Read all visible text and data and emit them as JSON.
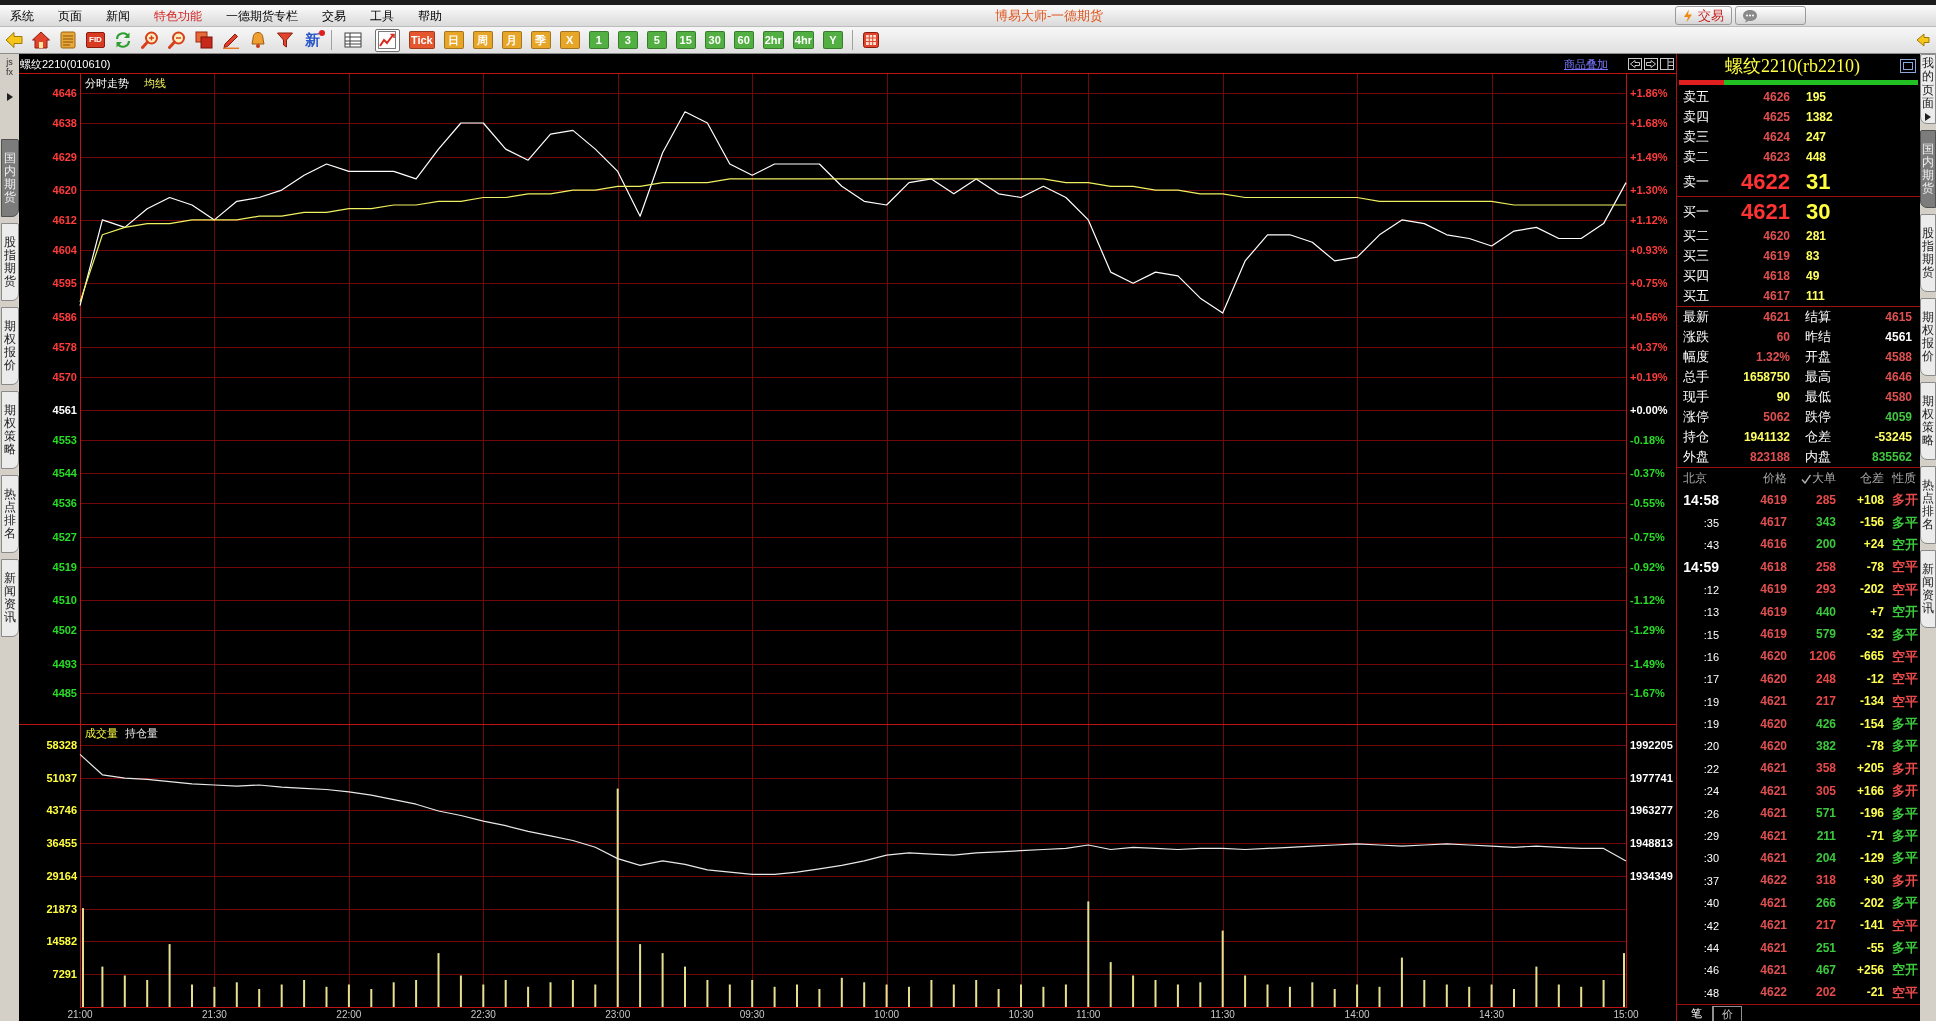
{
  "menu_bar": {
    "items": [
      {
        "label": "系统",
        "highlighted": false
      },
      {
        "label": "页面",
        "highlighted": false
      },
      {
        "label": "新闻",
        "highlighted": false
      },
      {
        "label": "特色功能",
        "highlighted": true
      },
      {
        "label": "一德期货专栏",
        "highlighted": false
      },
      {
        "label": "交易",
        "highlighted": false
      },
      {
        "label": "工具",
        "highlighted": false
      },
      {
        "label": "帮助",
        "highlighted": false
      }
    ],
    "app_title": "博易大师-一德期货",
    "trade_button": "交易"
  },
  "toolbar": {
    "fid_label": "FID",
    "news_label": "新",
    "view_buttons": [
      {
        "kind": "table",
        "selected": false
      },
      {
        "kind": "chart",
        "selected": true
      }
    ],
    "period_buttons": [
      {
        "label": "Tick",
        "color": "#e4572e"
      },
      {
        "label": "日",
        "color": "#e8a628"
      },
      {
        "label": "周",
        "color": "#e8a628"
      },
      {
        "label": "月",
        "color": "#e8a628"
      },
      {
        "label": "季",
        "color": "#e8a628"
      },
      {
        "label": "X",
        "color": "#e8a628"
      },
      {
        "label": "1",
        "color": "#52b043"
      },
      {
        "label": "3",
        "color": "#52b043"
      },
      {
        "label": "5",
        "color": "#52b043"
      },
      {
        "label": "15",
        "color": "#52b043"
      },
      {
        "label": "30",
        "color": "#52b043"
      },
      {
        "label": "60",
        "color": "#52b043"
      },
      {
        "label": "2hr",
        "color": "#52b043"
      },
      {
        "label": "4hr",
        "color": "#52b043"
      },
      {
        "label": "Y",
        "color": "#52b043"
      }
    ]
  },
  "left_tabs": {
    "script_label": "js fx",
    "tabs": [
      {
        "label": "国内期货",
        "selected": true
      },
      {
        "label": "股指期货",
        "selected": false
      },
      {
        "label": "期权报价",
        "selected": false
      },
      {
        "label": "期权策略",
        "selected": false
      },
      {
        "label": "热点排名",
        "selected": false
      },
      {
        "label": "新闻资讯",
        "selected": false
      }
    ]
  },
  "price_chart": {
    "symbol": "螺纹2210(010610)",
    "overlay_link": "商品叠加",
    "percent_labels": [
      {
        "text": "+1.86%",
        "color": "#ff3c3c"
      },
      {
        "text": "+1.68%",
        "color": "#ff3c3c"
      },
      {
        "text": "+1.49%",
        "color": "#ff3c3c"
      },
      {
        "text": "+1.30%",
        "color": "#ff3c3c"
      },
      {
        "text": "+1.12%",
        "color": "#ff3c3c"
      },
      {
        "text": "+0.93%",
        "color": "#ff3c3c"
      },
      {
        "text": "+0.75%",
        "color": "#ff3c3c"
      },
      {
        "text": "+0.56%",
        "color": "#ff3c3c"
      },
      {
        "text": "+0.37%",
        "color": "#ff3c3c"
      },
      {
        "text": "+0.19%",
        "color": "#ff3c3c"
      },
      {
        "text": "+0.00%",
        "color": "#ffffff"
      },
      {
        "text": "-0.18%",
        "color": "#28dc28"
      },
      {
        "text": "-0.37%",
        "color": "#28dc28"
      },
      {
        "text": "-0.55%",
        "color": "#28dc28"
      },
      {
        "text": "-0.75%",
        "color": "#28dc28"
      },
      {
        "text": "-0.92%",
        "color": "#28dc28"
      },
      {
        "text": "-1.12%",
        "color": "#28dc28"
      },
      {
        "text": "-1.29%",
        "color": "#28dc28"
      },
      {
        "text": "-1.49%",
        "color": "#28dc28"
      },
      {
        "text": "-1.67%",
        "color": "#28dc28"
      }
    ],
    "chart_data": {
      "type": "line",
      "grid": true,
      "series": [
        {
          "name": "分时走势",
          "color": "#ffffff",
          "values": [
            4589,
            4612,
            4610,
            4615,
            4618,
            4616,
            4612,
            4617,
            4618,
            4620,
            4624,
            4627,
            4625,
            4625,
            4625,
            4623,
            4631,
            4638,
            4638,
            4631,
            4628,
            4635,
            4636,
            4631,
            4625,
            4613,
            4630,
            4641,
            4638,
            4627,
            4624,
            4627,
            4627,
            4627,
            4621,
            4617,
            4616,
            4622,
            4623,
            4619,
            4623,
            4619,
            4618,
            4621,
            4618,
            4612,
            4598,
            4595,
            4598,
            4597,
            4591,
            4587,
            4601,
            4608,
            4608,
            4606,
            4601,
            4602,
            4608,
            4612,
            4611,
            4608,
            4607,
            4605,
            4609,
            4610,
            4607,
            4607,
            4611,
            4622
          ]
        },
        {
          "name": "均线",
          "color": "#f0f060",
          "values": [
            4590,
            4608,
            4610,
            4611,
            4611,
            4612,
            4612,
            4612,
            4613,
            4613,
            4614,
            4614,
            4615,
            4615,
            4616,
            4616,
            4617,
            4617,
            4618,
            4618,
            4619,
            4619,
            4620,
            4620,
            4621,
            4621,
            4622,
            4622,
            4622,
            4623,
            4623,
            4623,
            4623,
            4623,
            4623,
            4623,
            4623,
            4623,
            4623,
            4623,
            4623,
            4623,
            4623,
            4623,
            4622,
            4622,
            4621,
            4621,
            4620,
            4620,
            4619,
            4619,
            4618,
            4618,
            4618,
            4618,
            4618,
            4618,
            4617,
            4617,
            4617,
            4617,
            4617,
            4617,
            4616,
            4616,
            4616,
            4616,
            4616,
            4616
          ]
        }
      ],
      "ylim": [
        4476.8,
        4651.4
      ],
      "yticks": [
        4646,
        4638,
        4629,
        4620,
        4612,
        4604,
        4595,
        4586,
        4578,
        4570,
        4561,
        4553,
        4544,
        4536,
        4527,
        4519,
        4510,
        4502,
        4493,
        4485
      ]
    }
  },
  "volume_chart": {
    "chart_data": {
      "type": "bar",
      "grid": true,
      "categories": [
        "21:00",
        null,
        null,
        null,
        null,
        null,
        "21:30",
        null,
        null,
        null,
        null,
        null,
        "22:00",
        null,
        null,
        null,
        null,
        null,
        "22:30",
        null,
        null,
        null,
        null,
        null,
        "23:00",
        null,
        null,
        null,
        null,
        null,
        "09:30",
        null,
        null,
        null,
        null,
        null,
        "10:00",
        null,
        null,
        null,
        null,
        null,
        "10:30",
        null,
        null,
        "11:00",
        null,
        null,
        null,
        null,
        null,
        "11:30",
        null,
        null,
        null,
        null,
        null,
        "14:00",
        null,
        null,
        null,
        null,
        null,
        "14:30",
        null,
        null,
        null,
        null,
        null,
        "15:00"
      ],
      "series": [
        {
          "name": "成交量",
          "color": "#e6e08c",
          "values": [
            22000,
            9000,
            7000,
            6000,
            14000,
            5000,
            4500,
            5500,
            4000,
            5000,
            6000,
            4500,
            5000,
            4000,
            5500,
            6000,
            12000,
            7000,
            5000,
            6000,
            4500,
            5500,
            6000,
            5000,
            48600,
            14000,
            12000,
            9000,
            6000,
            5000,
            6000,
            4500,
            5000,
            4000,
            6500,
            5500,
            5000,
            4500,
            6000,
            5000,
            6000,
            4000,
            5000,
            4500,
            5000,
            23500,
            10000,
            7000,
            6000,
            5000,
            5500,
            17000,
            7000,
            5000,
            4500,
            5500,
            4000,
            5000,
            4500,
            11000,
            6000,
            5000,
            4500,
            5000,
            4000,
            9000,
            5000,
            4500,
            6000,
            12000
          ]
        }
      ],
      "ylim": [
        0,
        62967
      ],
      "yticks": [
        58328,
        51037,
        43746,
        36455,
        29164,
        21873,
        14582,
        7291
      ]
    }
  },
  "open_interest_chart": {
    "chart_data": {
      "type": "line",
      "series": [
        {
          "name": "持仓量",
          "color": "#e8e8e8",
          "values": [
            1988000,
            1979000,
            1977500,
            1977000,
            1976000,
            1975000,
            1974500,
            1974000,
            1974500,
            1973500,
            1973000,
            1972500,
            1971500,
            1970000,
            1968000,
            1966000,
            1963000,
            1961000,
            1958500,
            1956500,
            1954000,
            1952000,
            1950000,
            1947000,
            1942000,
            1939000,
            1941000,
            1939500,
            1937000,
            1936000,
            1935000,
            1935000,
            1936000,
            1937500,
            1939000,
            1941000,
            1943500,
            1944500,
            1944000,
            1943500,
            1944500,
            1945000,
            1945500,
            1946000,
            1946500,
            1948000,
            1946000,
            1947000,
            1946500,
            1946000,
            1946500,
            1946500,
            1946000,
            1946500,
            1947000,
            1947500,
            1948000,
            1948500,
            1948000,
            1947500,
            1948000,
            1948500,
            1948000,
            1947500,
            1947000,
            1947500,
            1947000,
            1946500,
            1946500,
            1941000
          ]
        }
      ],
      "ylim": [
        1934349,
        1992205
      ],
      "yticks": [
        1992205,
        1977741,
        1963277,
        1948813,
        1934349
      ]
    }
  },
  "quote_panel": {
    "title": "螺纹2210(rb2210)",
    "ratio_bar": {
      "level": 0.19
    },
    "asks": [
      {
        "label": "卖五",
        "price": "4626",
        "volume": "195",
        "kind": "level"
      },
      {
        "label": "卖四",
        "price": "4625",
        "volume": "1382",
        "kind": "level"
      },
      {
        "label": "卖三",
        "price": "4624",
        "volume": "247",
        "kind": "level"
      },
      {
        "label": "卖二",
        "price": "4623",
        "volume": "448",
        "kind": "level"
      },
      {
        "label": "卖一",
        "price": "4622",
        "volume": "31",
        "kind": "best"
      }
    ],
    "bids": [
      {
        "label": "买一",
        "price": "4621",
        "volume": "30",
        "kind": "best"
      },
      {
        "label": "买二",
        "price": "4620",
        "volume": "281",
        "kind": "level"
      },
      {
        "label": "买三",
        "price": "4619",
        "volume": "83",
        "kind": "level"
      },
      {
        "label": "买四",
        "price": "4618",
        "volume": "49",
        "kind": "level"
      },
      {
        "label": "买五",
        "price": "4617",
        "volume": "111",
        "kind": "level"
      }
    ],
    "stats": [
      {
        "label": "最新",
        "value": "4621",
        "color": "#e05050"
      },
      {
        "label": "结算",
        "value": "4615",
        "color": "#e05050"
      },
      {
        "label": "涨跌",
        "value": "60",
        "color": "#e05050"
      },
      {
        "label": "昨结",
        "value": "4561",
        "color": "#ffffff"
      },
      {
        "label": "幅度",
        "value": "1.32%",
        "color": "#e05050"
      },
      {
        "label": "开盘",
        "value": "4588",
        "color": "#e05050"
      },
      {
        "label": "总手",
        "value": "1658750",
        "color": "#ffff60"
      },
      {
        "label": "最高",
        "value": "4646",
        "color": "#e05050"
      },
      {
        "label": "现手",
        "value": "90",
        "color": "#ffff60"
      },
      {
        "label": "最低",
        "value": "4580",
        "color": "#e05050"
      },
      {
        "label": "涨停",
        "value": "5062",
        "color": "#e05050"
      },
      {
        "label": "跌停",
        "value": "4059",
        "color": "#40c840"
      },
      {
        "label": "持仓",
        "value": "1941132",
        "color": "#ffff60"
      },
      {
        "label": "仓差",
        "value": "-53245",
        "color": "#ffff60"
      },
      {
        "label": "外盘",
        "value": "823188",
        "color": "#e05050"
      },
      {
        "label": "内盘",
        "value": "835562",
        "color": "#40c840"
      }
    ],
    "trades": {
      "columns": [
        "北京",
        "价格",
        "大单",
        "仓差",
        "性质"
      ],
      "big_order_filter": {
        "checked": true
      },
      "rows": [
        {
          "time": "14:58",
          "kind": "minute",
          "price": "4619",
          "volume": {
            "text": "285",
            "color": "#e84a4a"
          },
          "change": "+108",
          "nature": {
            "text": "多开",
            "color": "#e84a4a"
          }
        },
        {
          "time": ":35",
          "kind": "second",
          "price": "4617",
          "volume": {
            "text": "343",
            "color": "#3cc83c"
          },
          "change": "-156",
          "nature": {
            "text": "多平",
            "color": "#3cc83c"
          }
        },
        {
          "time": ":43",
          "kind": "second",
          "price": "4616",
          "volume": {
            "text": "200",
            "color": "#3cc83c"
          },
          "change": "+24",
          "nature": {
            "text": "空开",
            "color": "#3cc83c"
          }
        },
        {
          "time": "14:59",
          "kind": "minute",
          "price": "4618",
          "volume": {
            "text": "258",
            "color": "#e84a4a"
          },
          "change": "-78",
          "nature": {
            "text": "空平",
            "color": "#e84a4a"
          }
        },
        {
          "time": ":12",
          "kind": "second",
          "price": "4619",
          "volume": {
            "text": "293",
            "color": "#e84a4a"
          },
          "change": "-202",
          "nature": {
            "text": "空平",
            "color": "#e84a4a"
          }
        },
        {
          "time": ":13",
          "kind": "second",
          "price": "4619",
          "volume": {
            "text": "440",
            "color": "#3cc83c"
          },
          "change": "+7",
          "nature": {
            "text": "空开",
            "color": "#3cc83c"
          }
        },
        {
          "time": ":15",
          "kind": "second",
          "price": "4619",
          "volume": {
            "text": "579",
            "color": "#3cc83c"
          },
          "change": "-32",
          "nature": {
            "text": "多平",
            "color": "#3cc83c"
          }
        },
        {
          "time": ":16",
          "kind": "second",
          "price": "4620",
          "volume": {
            "text": "1206",
            "color": "#e84a4a"
          },
          "change": "-665",
          "nature": {
            "text": "空平",
            "color": "#e84a4a"
          }
        },
        {
          "time": ":17",
          "kind": "second",
          "price": "4620",
          "volume": {
            "text": "248",
            "color": "#e84a4a"
          },
          "change": "-12",
          "nature": {
            "text": "空平",
            "color": "#e84a4a"
          }
        },
        {
          "time": ":19",
          "kind": "second",
          "price": "4621",
          "volume": {
            "text": "217",
            "color": "#e84a4a"
          },
          "change": "-134",
          "nature": {
            "text": "空平",
            "color": "#e84a4a"
          }
        },
        {
          "time": ":19",
          "kind": "second",
          "price": "4620",
          "volume": {
            "text": "426",
            "color": "#3cc83c"
          },
          "change": "-154",
          "nature": {
            "text": "多平",
            "color": "#3cc83c"
          }
        },
        {
          "time": ":20",
          "kind": "second",
          "price": "4620",
          "volume": {
            "text": "382",
            "color": "#3cc83c"
          },
          "change": "-78",
          "nature": {
            "text": "多平",
            "color": "#3cc83c"
          }
        },
        {
          "time": ":22",
          "kind": "second",
          "price": "4621",
          "volume": {
            "text": "358",
            "color": "#e84a4a"
          },
          "change": "+205",
          "nature": {
            "text": "多开",
            "color": "#e84a4a"
          }
        },
        {
          "time": ":24",
          "kind": "second",
          "price": "4621",
          "volume": {
            "text": "305",
            "color": "#e84a4a"
          },
          "change": "+166",
          "nature": {
            "text": "多开",
            "color": "#e84a4a"
          }
        },
        {
          "time": ":26",
          "kind": "second",
          "price": "4621",
          "volume": {
            "text": "571",
            "color": "#3cc83c"
          },
          "change": "-196",
          "nature": {
            "text": "多平",
            "color": "#3cc83c"
          }
        },
        {
          "time": ":29",
          "kind": "second",
          "price": "4621",
          "volume": {
            "text": "211",
            "color": "#3cc83c"
          },
          "change": "-71",
          "nature": {
            "text": "多平",
            "color": "#3cc83c"
          }
        },
        {
          "time": ":30",
          "kind": "second",
          "price": "4621",
          "volume": {
            "text": "204",
            "color": "#3cc83c"
          },
          "change": "-129",
          "nature": {
            "text": "多平",
            "color": "#3cc83c"
          }
        },
        {
          "time": ":37",
          "kind": "second",
          "price": "4622",
          "volume": {
            "text": "318",
            "color": "#e84a4a"
          },
          "change": "+30",
          "nature": {
            "text": "多开",
            "color": "#e84a4a"
          }
        },
        {
          "time": ":40",
          "kind": "second",
          "price": "4621",
          "volume": {
            "text": "266",
            "color": "#3cc83c"
          },
          "change": "-202",
          "nature": {
            "text": "多平",
            "color": "#3cc83c"
          }
        },
        {
          "time": ":42",
          "kind": "second",
          "price": "4621",
          "volume": {
            "text": "217",
            "color": "#e84a4a"
          },
          "change": "-141",
          "nature": {
            "text": "空平",
            "color": "#e84a4a"
          }
        },
        {
          "time": ":44",
          "kind": "second",
          "price": "4621",
          "volume": {
            "text": "251",
            "color": "#3cc83c"
          },
          "change": "-55",
          "nature": {
            "text": "多平",
            "color": "#3cc83c"
          }
        },
        {
          "time": ":46",
          "kind": "second",
          "price": "4621",
          "volume": {
            "text": "467",
            "color": "#3cc83c"
          },
          "change": "+256",
          "nature": {
            "text": "空开",
            "color": "#3cc83c"
          }
        },
        {
          "time": ":48",
          "kind": "second",
          "price": "4622",
          "volume": {
            "text": "202",
            "color": "#e84a4a"
          },
          "change": "-21",
          "nature": {
            "text": "空平",
            "color": "#e84a4a"
          }
        }
      ]
    },
    "bottom_tabs": [
      {
        "label": "笔",
        "selected": true
      },
      {
        "label": "价",
        "selected": false
      }
    ]
  },
  "right_tabs": [
    {
      "label": "我的页面",
      "kind": "menu",
      "selected": false
    },
    {
      "label": "国内期货",
      "kind": "tab",
      "selected": true
    },
    {
      "label": "股指期货",
      "kind": "tab",
      "selected": false
    },
    {
      "label": "期权报价",
      "kind": "tab",
      "selected": false
    },
    {
      "label": "期权策略",
      "kind": "tab",
      "selected": false
    },
    {
      "label": "热点排名",
      "kind": "tab",
      "selected": false
    },
    {
      "label": "新闻资讯",
      "kind": "tab",
      "selected": false
    }
  ]
}
